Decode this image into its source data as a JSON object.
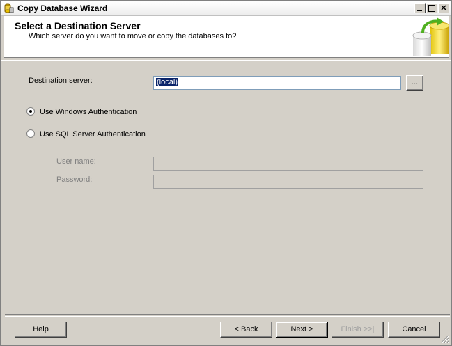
{
  "window": {
    "title": "Copy Database Wizard"
  },
  "header": {
    "title": "Select a Destination Server",
    "subtitle": "Which server do you want to move or copy the databases to?"
  },
  "form": {
    "destination_label": "Destination server:",
    "destination_value": "(local)",
    "browse_label": "...",
    "auth_windows_label": "Use Windows Authentication",
    "auth_sql_label": "Use SQL Server Authentication",
    "auth_selected": "windows",
    "username_label": "User name:",
    "password_label": "Password:"
  },
  "footer": {
    "help": "Help",
    "back": "< Back",
    "next": "Next >",
    "finish": "Finish >>|",
    "cancel": "Cancel"
  }
}
